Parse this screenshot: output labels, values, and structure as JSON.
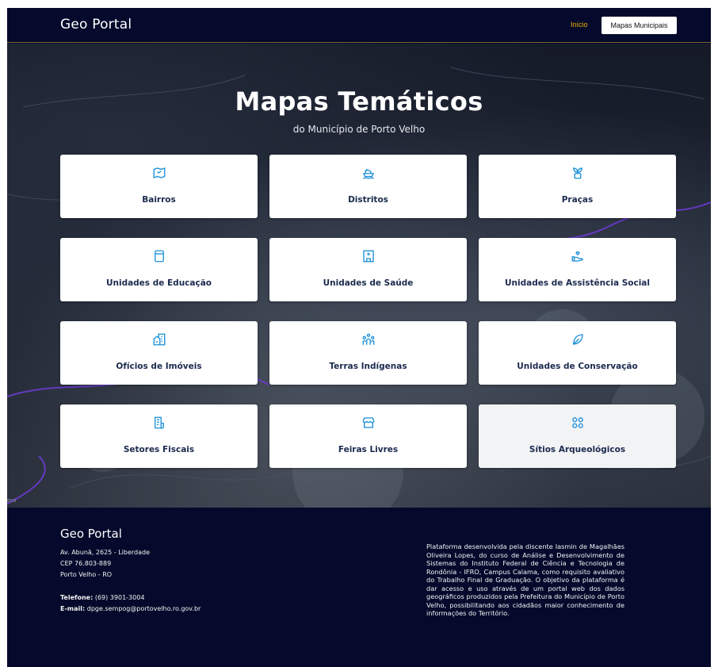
{
  "navbar": {
    "brand": "Geo Portal",
    "links": [
      {
        "label": "Início",
        "color": "#f0b400"
      },
      {
        "label": "Mapas Municipais"
      }
    ]
  },
  "hero": {
    "title": "Mapas Temáticos",
    "subtitle": "do Município de Porto Velho",
    "corner_text": "eco"
  },
  "cards": [
    {
      "label": "Bairros",
      "icon": "map-icon"
    },
    {
      "label": "Distritos",
      "icon": "ship-icon"
    },
    {
      "label": "Praças",
      "icon": "plant-icon"
    },
    {
      "label": "Unidades de Educação",
      "icon": "book-icon"
    },
    {
      "label": "Unidades de Saúde",
      "icon": "hospital-icon"
    },
    {
      "label": "Unidades de Assistência Social",
      "icon": "heart-hand-icon"
    },
    {
      "label": "Ofícios de Imóveis",
      "icon": "building-icon"
    },
    {
      "label": "Terras Indígenas",
      "icon": "people-icon"
    },
    {
      "label": "Unidades de Conservação",
      "icon": "leaf-icon"
    },
    {
      "label": "Setores Fiscais",
      "icon": "receipt-icon"
    },
    {
      "label": "Feiras Livres",
      "icon": "store-icon"
    },
    {
      "label": "Sítios Arqueológicos",
      "icon": "circles-icon"
    }
  ],
  "colors": {
    "accent": "#1a8fd9",
    "navy": "#050a2c",
    "card_text": "#1b2a4e"
  },
  "footer": {
    "brand": "Geo Portal",
    "address_1": "Av. Abunã, 2625 - Liberdade",
    "address_2": "CEP 76.803-889",
    "address_3": "Porto Velho - RO",
    "phone_label": "Telefone:",
    "phone": "(69) 3901-3004",
    "email_label": "E-mail:",
    "email": "dpge.sempog@portovelho.ro.gov.br",
    "about": "Plataforma desenvolvida pela discente Iasmin de Magalhães Oliveira Lopes, do curso de Análise e Desenvolvimento de Sistemas do Instituto Federal de Ciência e Tecnologia de Rondônia - IFRO, Campus Calama, como requisito avaliativo do Trabalho Final de Graduação. O objetivo da plataforma é dar acesso e uso através de um portal web dos dados geográficos produzidos pela Prefeitura do Município de Porto Velho, possibilitando aos cidadãos maior conhecimento de informações do Território."
  }
}
